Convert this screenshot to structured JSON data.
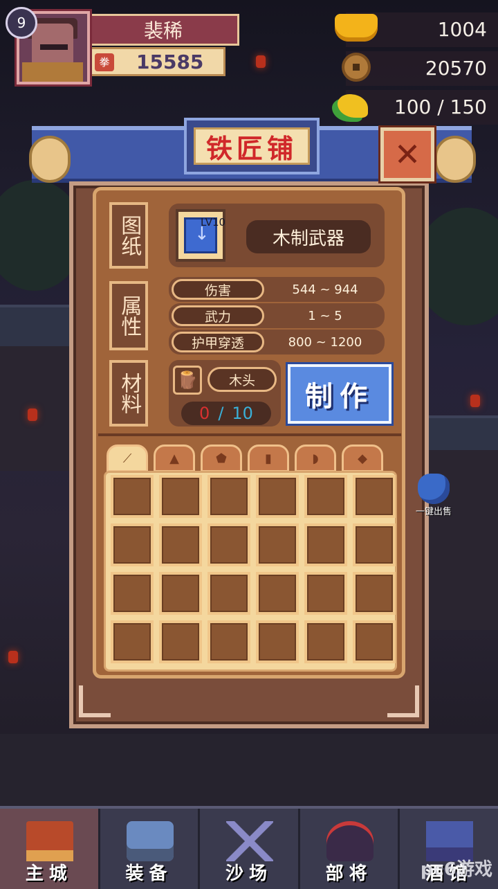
{
  "hud": {
    "level": "9",
    "player_name": "裴稀",
    "power_icon": "拳",
    "power": "15585",
    "gold": "1004",
    "copper": "20570",
    "stamina": "100 / 150"
  },
  "panel": {
    "title": "铁匠铺",
    "close_icon": "close-x",
    "sections": {
      "blueprint": "图纸",
      "attributes": "属性",
      "materials": "材料"
    },
    "blueprint": {
      "level": "LV10",
      "name": "木制武器"
    },
    "attributes": [
      {
        "key": "伤害",
        "value": "544 ~ 944"
      },
      {
        "key": "武力",
        "value": "1 ~ 5"
      },
      {
        "key": "护甲穿透",
        "value": "800 ~ 1200"
      }
    ],
    "material": {
      "name": "木头",
      "have": "0",
      "sep": "/",
      "need": "10"
    },
    "craft_label": "制作",
    "tabs": [
      "weapon-icon",
      "helmet-icon",
      "armor-icon",
      "boots-icon",
      "gloves-icon",
      "accessory-icon"
    ],
    "active_tab": 0
  },
  "sell_all_label": "一键出售",
  "nav": [
    {
      "label": "主城",
      "icon": "castle-icon"
    },
    {
      "label": "装备",
      "icon": "chest-icon"
    },
    {
      "label": "沙场",
      "icon": "crossed-swords-icon"
    },
    {
      "label": "部将",
      "icon": "helmet-icon"
    },
    {
      "label": "酒馆",
      "icon": "tower-icon"
    }
  ],
  "watermark": "pc6游戏"
}
